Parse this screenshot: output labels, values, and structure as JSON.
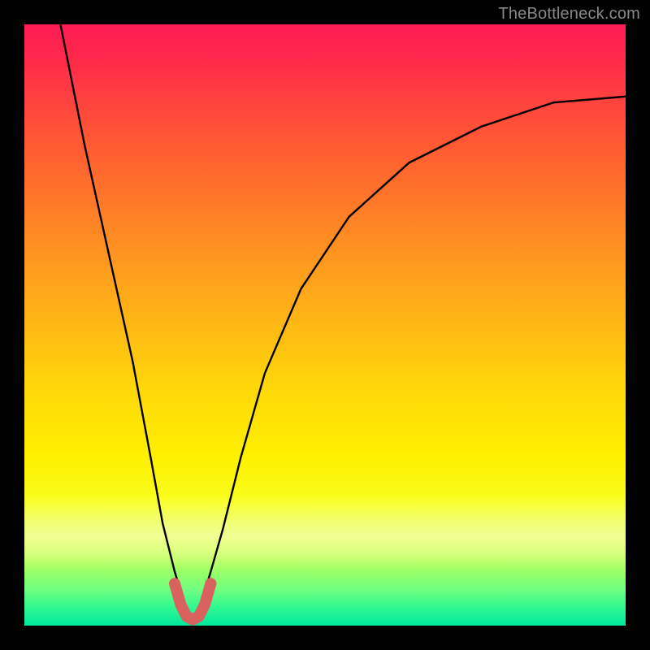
{
  "watermark": "TheBottleneck.com",
  "chart_data": {
    "type": "line",
    "title": "",
    "xlabel": "",
    "ylabel": "",
    "xlim": [
      0,
      100
    ],
    "ylim": [
      0,
      100
    ],
    "series": [
      {
        "name": "bottleneck-curve",
        "x": [
          6,
          10,
          14,
          18,
          21,
          23,
          25,
          26.5,
          28,
          29.5,
          31,
          33,
          36,
          40,
          46,
          54,
          64,
          76,
          88,
          100
        ],
        "values": [
          100,
          80,
          62,
          44,
          28,
          17,
          9,
          4,
          1,
          4,
          9,
          16,
          28,
          42,
          56,
          68,
          77,
          83,
          87,
          88
        ]
      }
    ],
    "highlight": {
      "name": "valley-segment",
      "x": [
        25,
        26,
        27,
        28,
        29,
        30,
        31
      ],
      "values": [
        7,
        3.5,
        1.5,
        1,
        1.5,
        3.5,
        7
      ],
      "color": "#d9625f",
      "stroke_width": 14
    },
    "grid": false,
    "legend": false
  }
}
